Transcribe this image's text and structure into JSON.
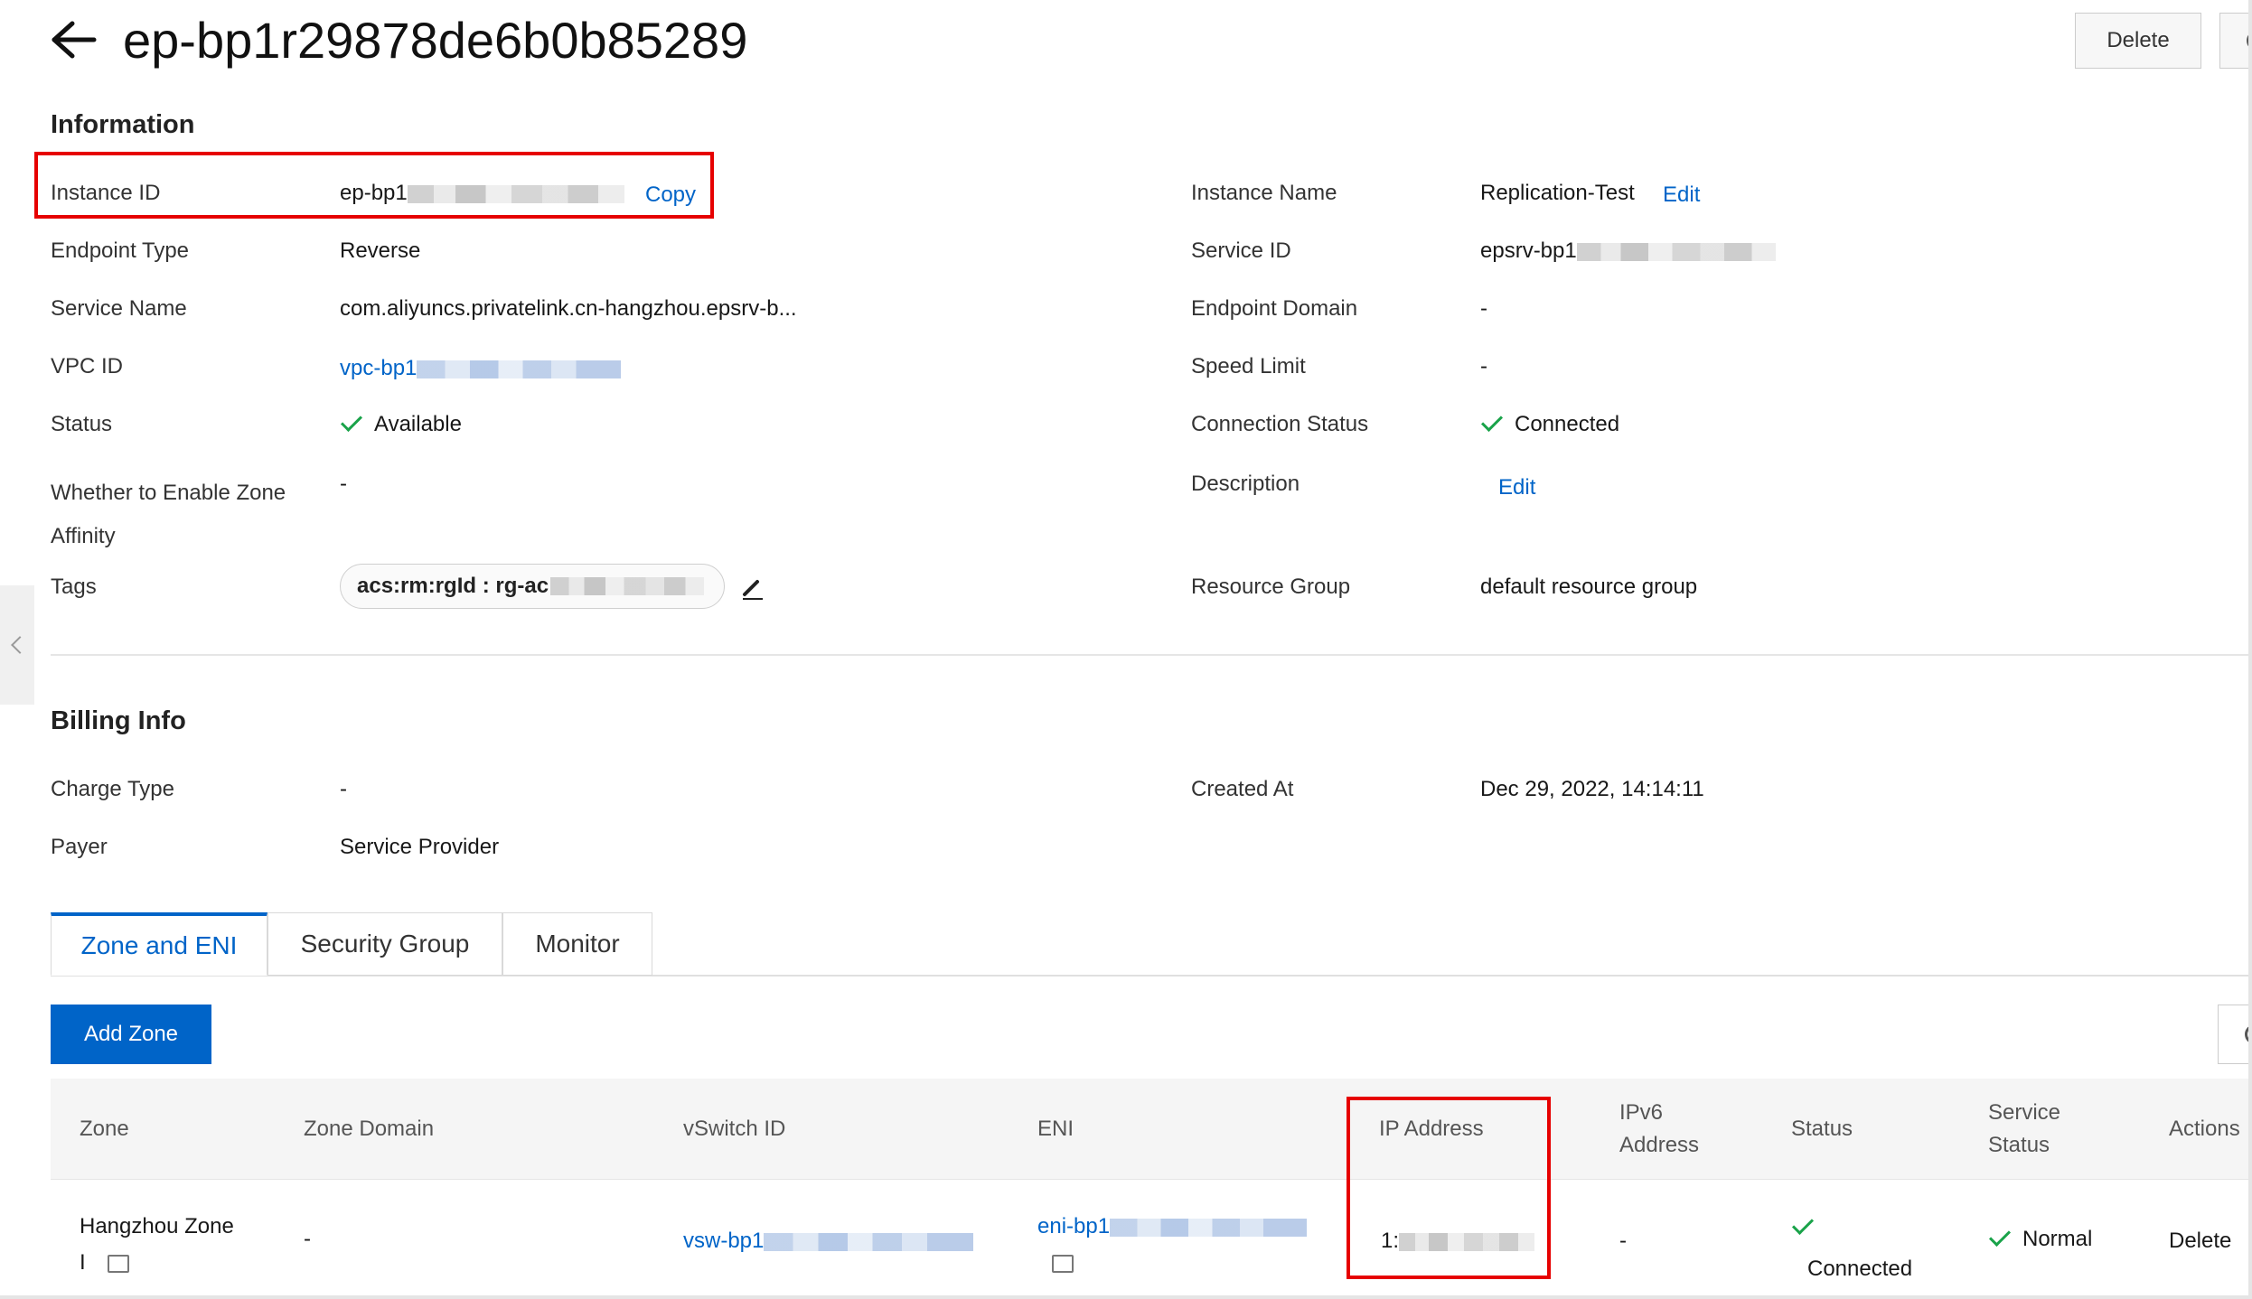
{
  "header": {
    "title": "ep-bp1r29878de6b0b85289",
    "delete_label": "Delete"
  },
  "information": {
    "section_title": "Information",
    "instance_id_label": "Instance ID",
    "instance_id_value": "ep-bp1",
    "copy_label": "Copy",
    "instance_name_label": "Instance Name",
    "instance_name_value": "Replication-Test",
    "edit_label": "Edit",
    "endpoint_type_label": "Endpoint Type",
    "endpoint_type_value": "Reverse",
    "service_id_label": "Service ID",
    "service_id_value": "epsrv-bp1",
    "service_name_label": "Service Name",
    "service_name_value": "com.aliyuncs.privatelink.cn-hangzhou.epsrv-b...",
    "endpoint_domain_label": "Endpoint Domain",
    "endpoint_domain_value": "-",
    "vpc_id_label": "VPC ID",
    "vpc_id_value": "vpc-bp1",
    "speed_limit_label": "Speed Limit",
    "speed_limit_value": "-",
    "status_label": "Status",
    "status_value": "Available",
    "connection_status_label": "Connection Status",
    "connection_status_value": "Connected",
    "zone_affinity_label_1": "Whether to Enable Zone",
    "zone_affinity_label_2": "Affinity",
    "zone_affinity_value": "-",
    "description_label": "Description",
    "description_edit_label": "Edit",
    "tags_label": "Tags",
    "tag_value": "acs:rm:rgId : rg-ac",
    "resource_group_label": "Resource Group",
    "resource_group_value": "default resource group"
  },
  "billing": {
    "section_title": "Billing Info",
    "charge_type_label": "Charge Type",
    "charge_type_value": "-",
    "created_at_label": "Created At",
    "created_at_value": "Dec 29, 2022, 14:14:11",
    "payer_label": "Payer",
    "payer_value": "Service Provider"
  },
  "tabs": {
    "zone_eni": "Zone and ENI",
    "security_group": "Security Group",
    "monitor": "Monitor"
  },
  "toolbar": {
    "add_zone_label": "Add Zone"
  },
  "table": {
    "headers": {
      "zone": "Zone",
      "zone_domain": "Zone Domain",
      "vswitch_id": "vSwitch ID",
      "eni": "ENI",
      "ip_address": "IP Address",
      "ipv6_1": "IPv6",
      "ipv6_2": "Address",
      "status": "Status",
      "service_status_1": "Service",
      "service_status_2": "Status",
      "actions": "Actions"
    },
    "row": {
      "zone_1": "Hangzhou Zone",
      "zone_2": "I",
      "zone_domain": "-",
      "vswitch_id": "vsw-bp1",
      "eni": "eni-bp1",
      "ip_address": "1:",
      "ipv6": "-",
      "status": "Connected",
      "service_status": "Normal",
      "action": "Delete"
    }
  },
  "colors": {
    "accent": "#0064c8",
    "success": "#1aa34a",
    "highlight": "#e60000"
  }
}
